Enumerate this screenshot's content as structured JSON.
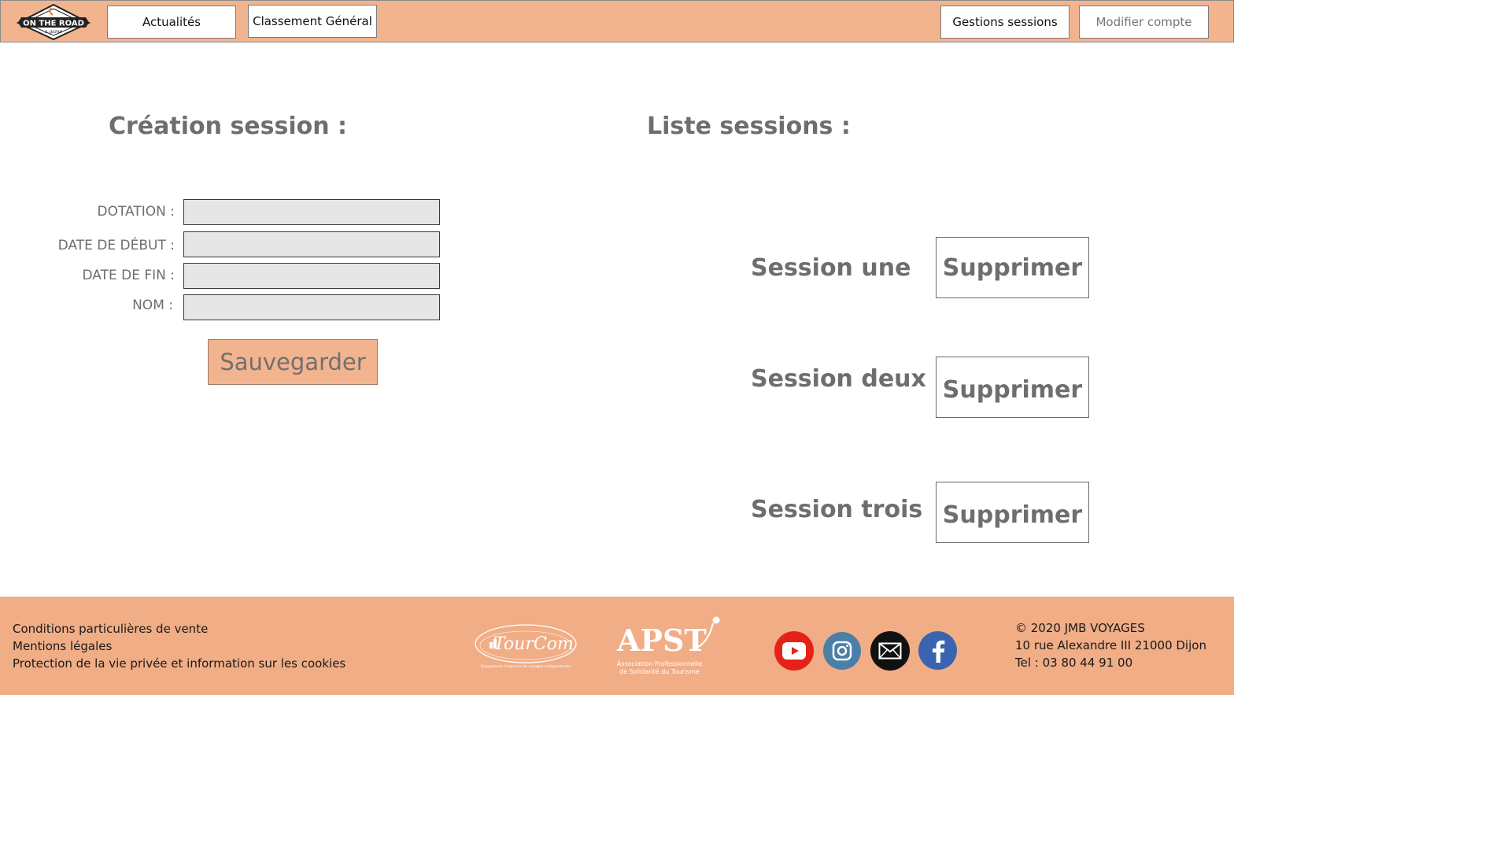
{
  "header": {
    "logo_text": "ON THE ROAD",
    "logo_sub": "a game",
    "nav_left": [
      {
        "label": "Actualités"
      },
      {
        "label": "Classement Général"
      }
    ],
    "nav_right": [
      {
        "label": "Gestions sessions"
      },
      {
        "label": "Modifier compte"
      }
    ]
  },
  "creation": {
    "title": "Création session :",
    "fields": [
      {
        "label": "DOTATION :",
        "value": ""
      },
      {
        "label": "DATE DE DÉBUT :",
        "value": ""
      },
      {
        "label": "DATE DE FIN :",
        "value": ""
      },
      {
        "label": "NOM :",
        "value": ""
      }
    ],
    "save_label": "Sauvegarder"
  },
  "list": {
    "title": "Liste sessions :",
    "sessions": [
      {
        "name": "Session une",
        "delete_label": "Supprimer"
      },
      {
        "name": "Session deux",
        "delete_label": "Supprimer"
      },
      {
        "name": "Session trois",
        "delete_label": "Supprimer"
      }
    ]
  },
  "footer": {
    "links": [
      {
        "label": "Conditions particulières de vente"
      },
      {
        "label": "Mentions légales"
      },
      {
        "label": "Protection de la vie privée et information sur les cookies"
      }
    ],
    "partners": {
      "tourcom": "TourCom",
      "tourcom_sub": "Groupement d'agences de voyages indépendantes",
      "apst": "APST",
      "apst_sub1": "Association Professionnelle",
      "apst_sub2": "de Solidarité du Tourisme"
    },
    "social": [
      {
        "icon": "youtube-icon",
        "color": "#e62117"
      },
      {
        "icon": "instagram-icon",
        "color": "#4a7fa8"
      },
      {
        "icon": "mail-icon",
        "color": "#111111"
      },
      {
        "icon": "facebook-icon",
        "color": "#3b64b0"
      }
    ],
    "info": [
      "© 2020 JMB VOYAGES",
      "10 rue Alexandre III 21000 Dijon",
      "Tel : 03 80 44 91 00"
    ]
  },
  "colors": {
    "accent": "#f2b48e",
    "footer_bg": "#f0ad86",
    "input_bg": "#e6e6e6"
  }
}
